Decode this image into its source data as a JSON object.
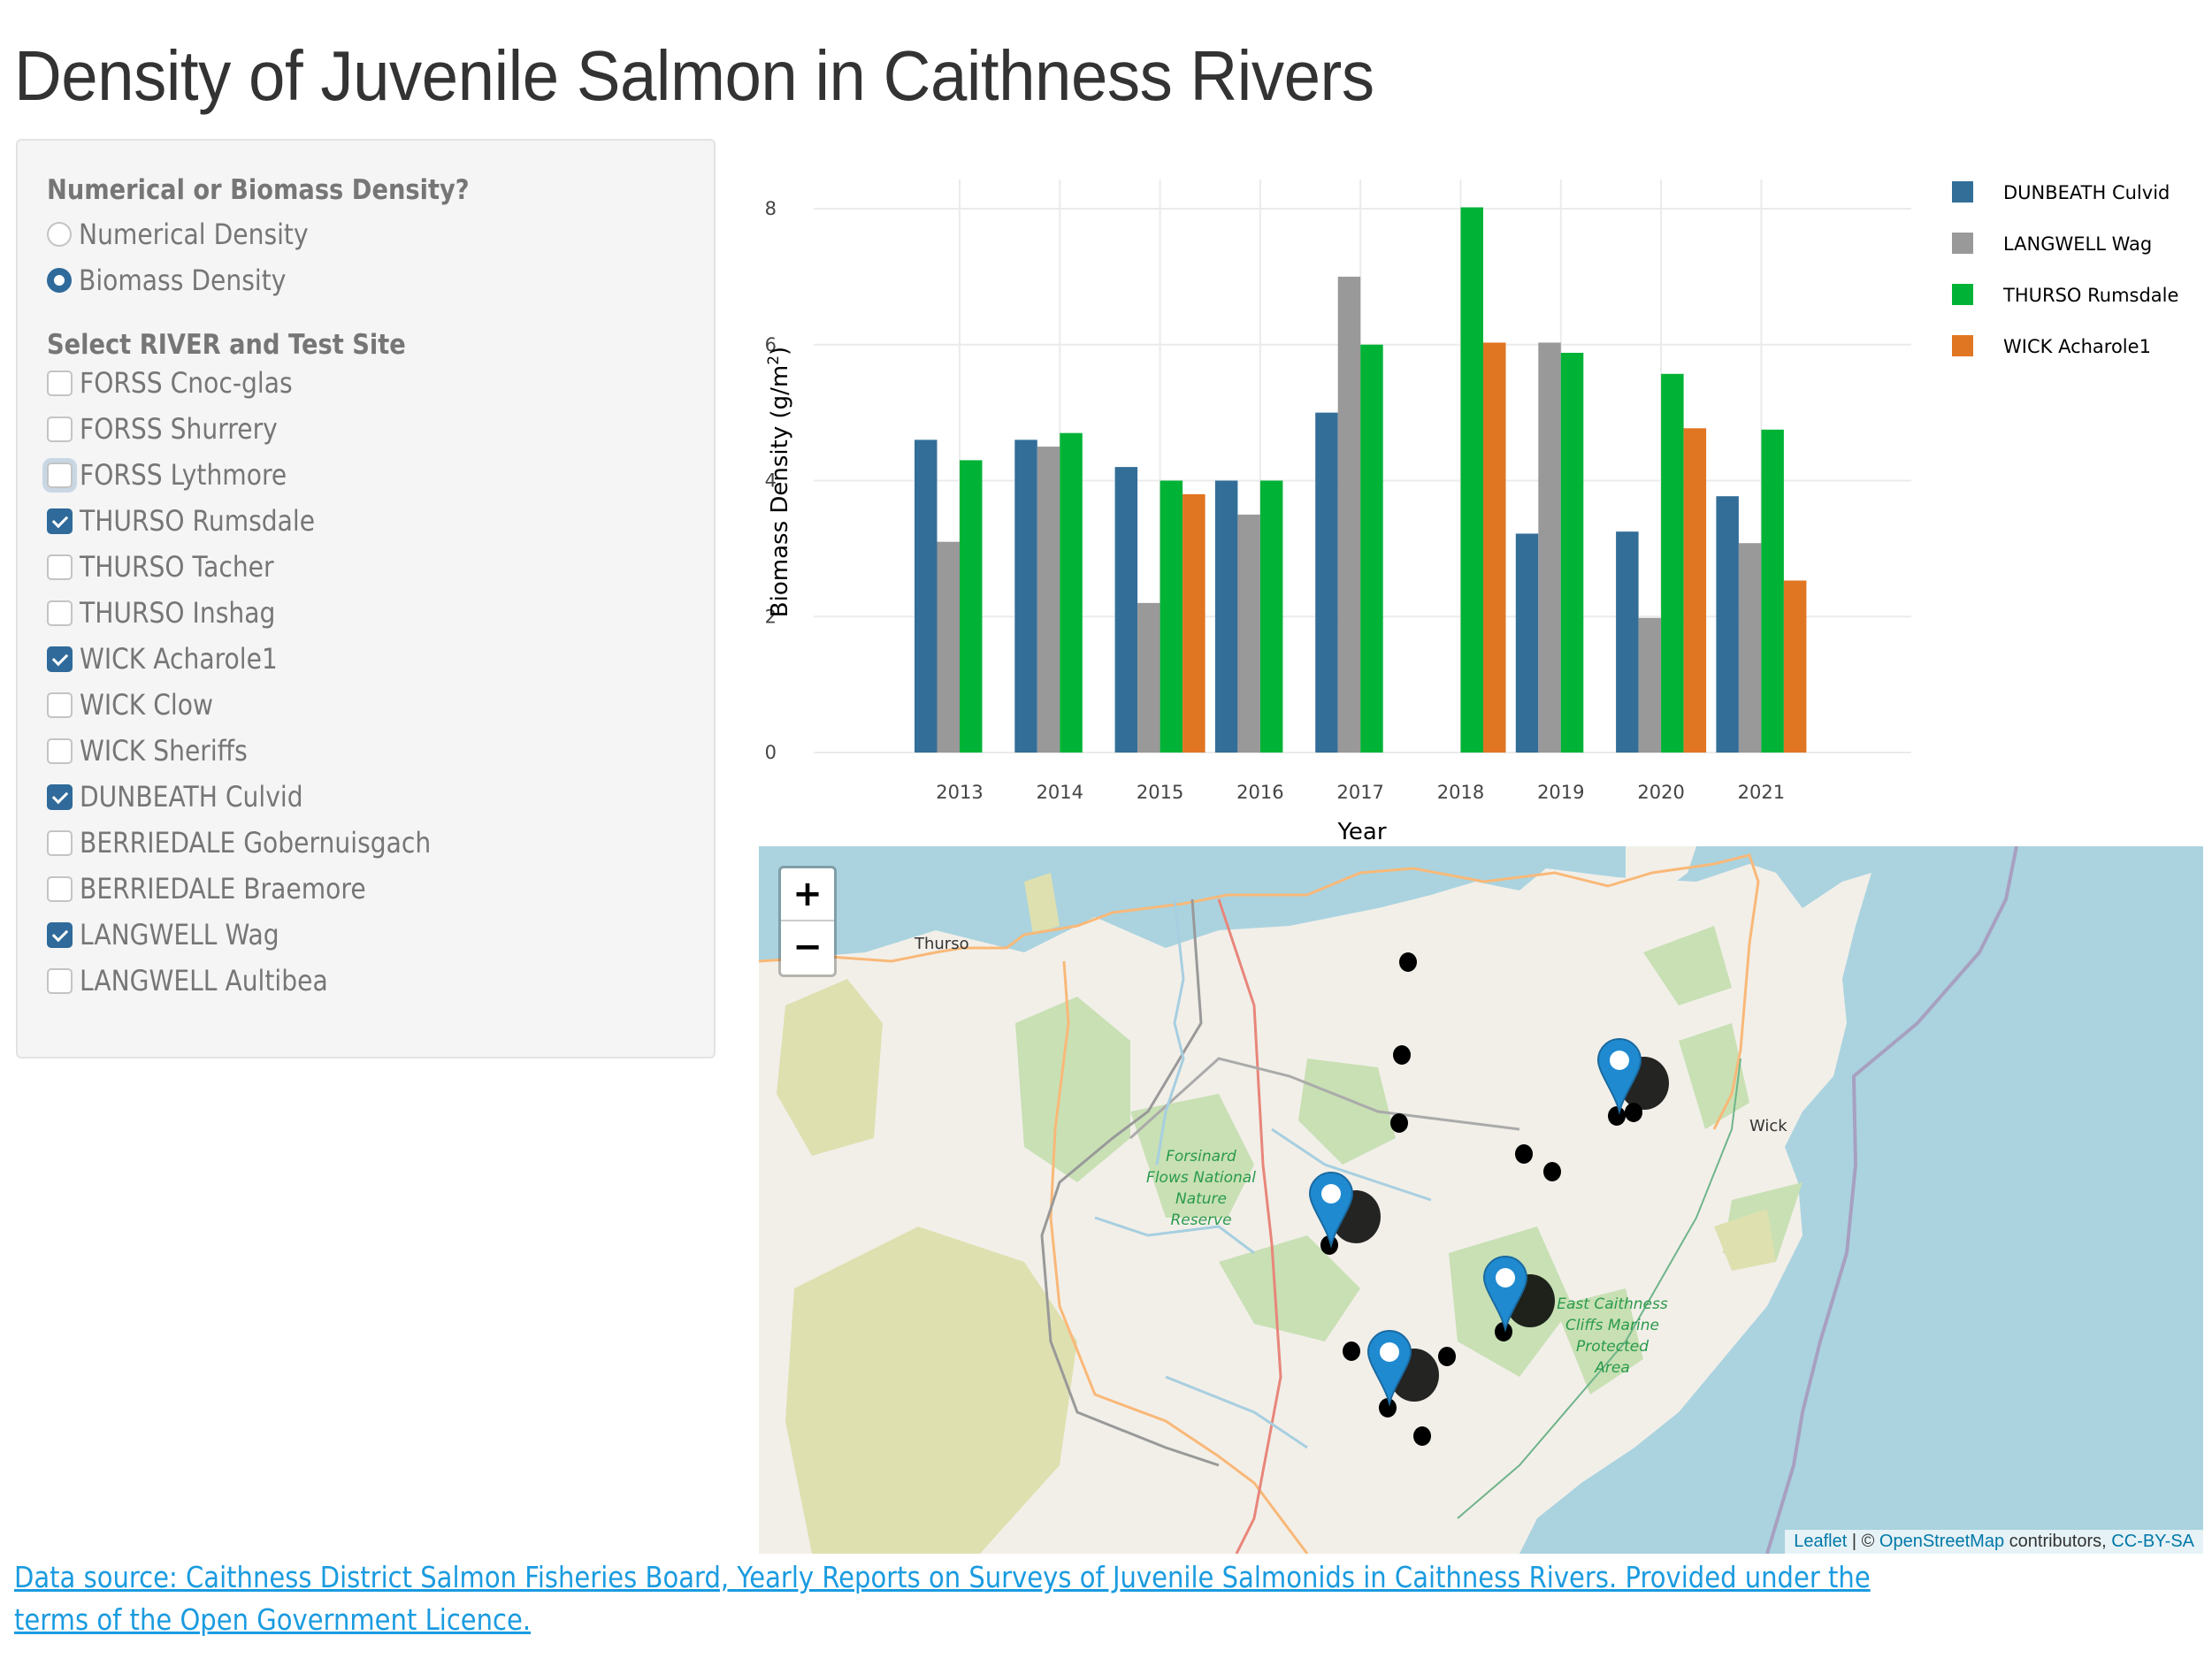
{
  "page": {
    "title": "Density of Juvenile Salmon in Caithness Rivers"
  },
  "sidebar": {
    "density_label": "Numerical or Biomass Density?",
    "density_options": [
      {
        "label": "Numerical Density",
        "selected": false
      },
      {
        "label": "Biomass Density",
        "selected": true
      }
    ],
    "sites_label": "Select RIVER and Test Site",
    "sites": [
      {
        "label": "FORSS Cnoc-glas",
        "checked": false
      },
      {
        "label": "FORSS Shurrery",
        "checked": false
      },
      {
        "label": "FORSS Lythmore",
        "checked": false,
        "focused": true
      },
      {
        "label": "THURSO Rumsdale",
        "checked": true
      },
      {
        "label": "THURSO Tacher",
        "checked": false
      },
      {
        "label": "THURSO Inshag",
        "checked": false
      },
      {
        "label": "WICK Acharole1",
        "checked": true
      },
      {
        "label": "WICK Clow",
        "checked": false
      },
      {
        "label": "WICK Sheriffs",
        "checked": false
      },
      {
        "label": "DUNBEATH Culvid",
        "checked": true
      },
      {
        "label": "BERRIEDALE Gobernuisgach",
        "checked": false
      },
      {
        "label": "BERRIEDALE Braemore",
        "checked": false
      },
      {
        "label": "LANGWELL Wag",
        "checked": true
      },
      {
        "label": "LANGWELL Aultibea",
        "checked": false
      }
    ]
  },
  "chart_data": {
    "type": "bar",
    "title": "",
    "xlabel": "Year",
    "ylabel": "Biomass Density (g/m²)",
    "ylabel_base": "Biomass Density (g/m",
    "ylabel_sup": "2",
    "ylabel_end": ")",
    "ylim": [
      0,
      8.3
    ],
    "yticks": [
      0,
      2,
      4,
      6,
      8
    ],
    "grid": true,
    "legend_position": "right",
    "categories": [
      "2013",
      "2014",
      "2015",
      "2016",
      "2017",
      "2018",
      "2019",
      "2020",
      "2021"
    ],
    "series": [
      {
        "name": "DUNBEATH Culvid",
        "color": "#336e99",
        "values": [
          4.6,
          4.6,
          4.2,
          4.0,
          5.0,
          null,
          3.22,
          3.25,
          3.77
        ]
      },
      {
        "name": "LANGWELL Wag",
        "color": "#999999",
        "values": [
          3.1,
          4.5,
          2.2,
          3.5,
          7.0,
          null,
          6.03,
          1.98,
          3.08
        ]
      },
      {
        "name": "THURSO Rumsdale",
        "color": "#00b336",
        "values": [
          4.3,
          4.7,
          4.0,
          4.0,
          6.0,
          8.02,
          5.88,
          5.57,
          4.75
        ]
      },
      {
        "name": "WICK Acharole1",
        "color": "#e07522",
        "values": [
          null,
          null,
          3.8,
          null,
          null,
          6.03,
          null,
          4.77,
          2.53
        ]
      }
    ]
  },
  "map": {
    "zoom_in": "+",
    "zoom_out": "−",
    "place_labels": [
      "Thurso",
      "Wick"
    ],
    "area_labels": [
      "Forsinard Flows National Nature Reserve",
      "East Caithness Cliffs Marine Protected Area"
    ],
    "attribution": {
      "leaflet": "Leaflet",
      "sep": " | © ",
      "osm": "OpenStreetMap",
      "contributors": " contributors, ",
      "license": "CC-BY-SA"
    },
    "marker_count": 4,
    "site_dot_count": 13
  },
  "footer": {
    "link_text": "Data source: Caithness District Salmon Fisheries Board, Yearly Reports on Surveys of Juvenile Salmonids in Caithness Rivers. Provided under the terms of the Open Government Licence."
  }
}
